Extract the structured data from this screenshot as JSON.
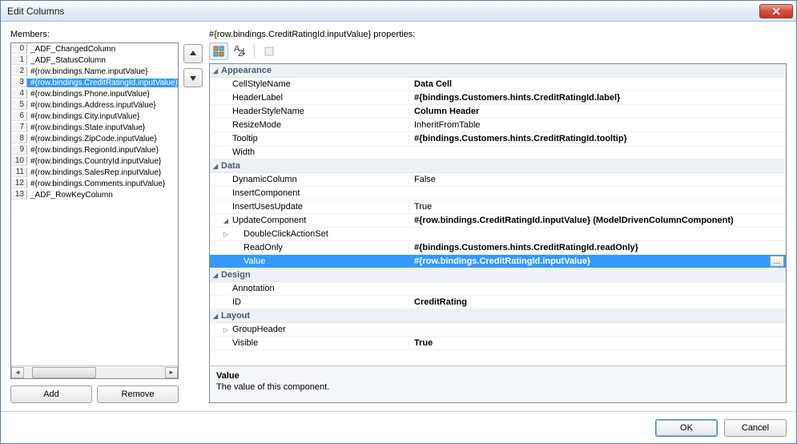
{
  "window": {
    "title": "Edit Columns"
  },
  "left": {
    "label": "Members:",
    "addLabel": "Add",
    "removeLabel": "Remove",
    "selectedIndex": 3,
    "items": [
      "_ADF_ChangedColumn",
      "_ADF_StatusColumn",
      "#{row.bindings.Name.inputValue}",
      "#{row.bindings.CreditRatingId.inputValue}",
      "#{row.bindings.Phone.inputValue}",
      "#{row.bindings.Address.inputValue}",
      "#{row.bindings.City.inputValue}",
      "#{row.bindings.State.inputValue}",
      "#{row.bindings.ZipCode.inputValue}",
      "#{row.bindings.RegionId.inputValue}",
      "#{row.bindings.CountryId.inputValue}",
      "#{row.bindings.SalesRep.inputValue}",
      "#{row.bindings.Comments.inputValue}",
      "_ADF_RowKeyColumn"
    ]
  },
  "right": {
    "label": "#{row.bindings.CreditRatingId.inputValue} properties:",
    "categories": [
      {
        "name": "Appearance",
        "expanded": true,
        "props": [
          {
            "name": "CellStyleName",
            "value": "Data Cell",
            "bold": true
          },
          {
            "name": "HeaderLabel",
            "value": "#{bindings.Customers.hints.CreditRatingId.label}",
            "bold": true
          },
          {
            "name": "HeaderStyleName",
            "value": "Column Header",
            "bold": true
          },
          {
            "name": "ResizeMode",
            "value": "InheritFromTable"
          },
          {
            "name": "Tooltip",
            "value": "#{bindings.Customers.hints.CreditRatingId.tooltip}",
            "bold": true
          },
          {
            "name": "Width",
            "value": ""
          }
        ]
      },
      {
        "name": "Data",
        "expanded": true,
        "props": [
          {
            "name": "DynamicColumn",
            "value": "False"
          },
          {
            "name": "InsertComponent",
            "value": ""
          },
          {
            "name": "InsertUsesUpdate",
            "value": "True"
          },
          {
            "name": "UpdateComponent",
            "value": "#{row.bindings.CreditRatingId.inputValue} (ModelDrivenColumnComponent)",
            "bold": true,
            "expandable": true,
            "children": [
              {
                "name": "DoubleClickActionSet",
                "value": "",
                "expandable": true
              },
              {
                "name": "ReadOnly",
                "value": "#{bindings.Customers.hints.CreditRatingId.readOnly}",
                "bold": true
              },
              {
                "name": "Value",
                "value": "#{row.bindings.CreditRatingId.inputValue}",
                "bold": true,
                "selected": true,
                "ellipsis": true
              }
            ]
          }
        ]
      },
      {
        "name": "Design",
        "expanded": true,
        "props": [
          {
            "name": "Annotation",
            "value": ""
          },
          {
            "name": "ID",
            "value": "CreditRating",
            "bold": true
          }
        ]
      },
      {
        "name": "Layout",
        "expanded": true,
        "props": [
          {
            "name": "GroupHeader",
            "value": "",
            "expandable": true
          },
          {
            "name": "Visible",
            "value": "True",
            "bold": true
          }
        ]
      }
    ],
    "desc": {
      "title": "Value",
      "text": "The value of this component."
    }
  },
  "footer": {
    "ok": "OK",
    "cancel": "Cancel"
  }
}
